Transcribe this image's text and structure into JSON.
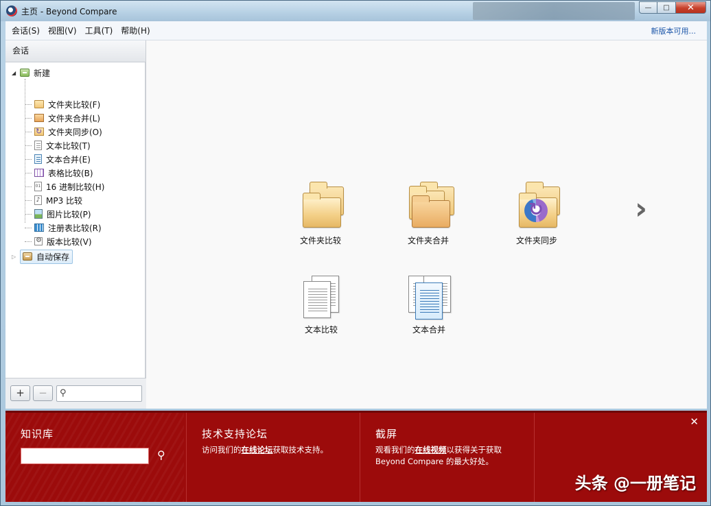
{
  "window": {
    "title": "主页 - Beyond Compare",
    "min_label": "—",
    "max_label": "□",
    "close_label": "✕"
  },
  "menu": {
    "items": [
      "会话(S)",
      "视图(V)",
      "工具(T)",
      "帮助(H)"
    ],
    "update_link": "新版本可用..."
  },
  "sidebar": {
    "header": "会话",
    "root": "新建",
    "items": [
      {
        "label": "文件夹比较(F)",
        "icon": "folder-compare-icon"
      },
      {
        "label": "文件夹合并(L)",
        "icon": "folder-merge-icon"
      },
      {
        "label": "文件夹同步(O)",
        "icon": "folder-sync-icon"
      },
      {
        "label": "文本比较(T)",
        "icon": "text-compare-icon"
      },
      {
        "label": "文本合并(E)",
        "icon": "text-merge-icon"
      },
      {
        "label": "表格比较(B)",
        "icon": "table-compare-icon"
      },
      {
        "label": "16 进制比较(H)",
        "icon": "hex-compare-icon"
      },
      {
        "label": "MP3 比较",
        "icon": "mp3-compare-icon"
      },
      {
        "label": "图片比较(P)",
        "icon": "picture-compare-icon"
      },
      {
        "label": "注册表比较(R)",
        "icon": "registry-compare-icon"
      },
      {
        "label": "版本比较(V)",
        "icon": "version-compare-icon"
      }
    ],
    "autosave": "自动保存",
    "add_label": "+",
    "remove_label": "−",
    "search_placeholder": ""
  },
  "main": {
    "tiles": [
      {
        "label": "文件夹比较",
        "icon": "folder-compare-icon"
      },
      {
        "label": "文件夹合并",
        "icon": "folder-merge-icon"
      },
      {
        "label": "文件夹同步",
        "icon": "folder-sync-icon"
      },
      {
        "label": "文本比较",
        "icon": "text-compare-icon"
      },
      {
        "label": "文本合并",
        "icon": "text-merge-icon"
      }
    ],
    "next_label": "›"
  },
  "bottom": {
    "kb_title": "知识库",
    "kb_placeholder": "",
    "forum_title": "技术支持论坛",
    "forum_text_pre": "访问我们的",
    "forum_link": "在线论坛",
    "forum_text_post": "获取技术支持。",
    "screen_title": "截屏",
    "screen_text_pre": "观看我们的",
    "screen_link": "在线视频",
    "screen_text_post": "以获得关于获取",
    "screen_text_line2": "Beyond Compare 的最大好处。",
    "close_label": "✕",
    "watermark": "头条 @一册笔记"
  },
  "colors": {
    "bottom_panel": "#9c0b0b",
    "accent_link": "#1a55a8"
  }
}
